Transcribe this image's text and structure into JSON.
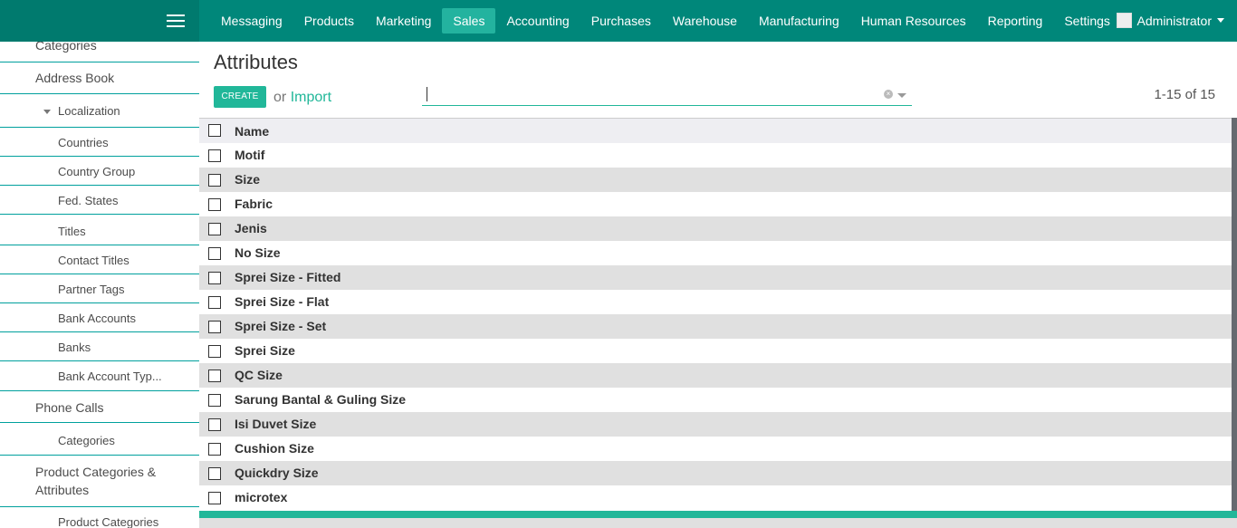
{
  "topbar": {
    "menu": [
      "Messaging",
      "Products",
      "Marketing",
      "Sales",
      "Accounting",
      "Purchases",
      "Warehouse",
      "Manufacturing",
      "Human Resources",
      "Reporting",
      "Settings"
    ],
    "active": "Sales",
    "user": "Administrator"
  },
  "sidebar": {
    "categories_top": "Categories",
    "address_book": "Address Book",
    "localization": "Localization",
    "countries": "Countries",
    "country_group": "Country Group",
    "fed_states": "Fed. States",
    "titles": "Titles",
    "contact_titles": "Contact Titles",
    "partner_tags": "Partner Tags",
    "bank_accounts": "Bank Accounts",
    "banks": "Banks",
    "bank_account_types": "Bank Account Typ...",
    "phone_calls": "Phone Calls",
    "phone_categories": "Categories",
    "product_categories_attrs_1": "Product Categories &",
    "product_categories_attrs_2": "Attributes",
    "product_categories": "Product Categories"
  },
  "main": {
    "title": "Attributes",
    "create_label": "CREATE",
    "or_label": "or",
    "import_label": "Import",
    "pager": "1-15 of 15"
  },
  "table": {
    "header": "Name",
    "rows": [
      "Motif",
      "Size",
      "Fabric",
      "Jenis",
      "No Size",
      "Sprei Size - Fitted",
      "Sprei Size - Flat",
      "Sprei Size - Set",
      "Sprei Size",
      "QC Size",
      "Sarung Bantal & Guling Size",
      "Isi Duvet Size",
      "Cushion Size",
      "Quickdry Size",
      "microtex"
    ]
  },
  "colors": {
    "topbar": "#00877a",
    "accent": "#21b799",
    "active_menu": "#23b39f"
  }
}
